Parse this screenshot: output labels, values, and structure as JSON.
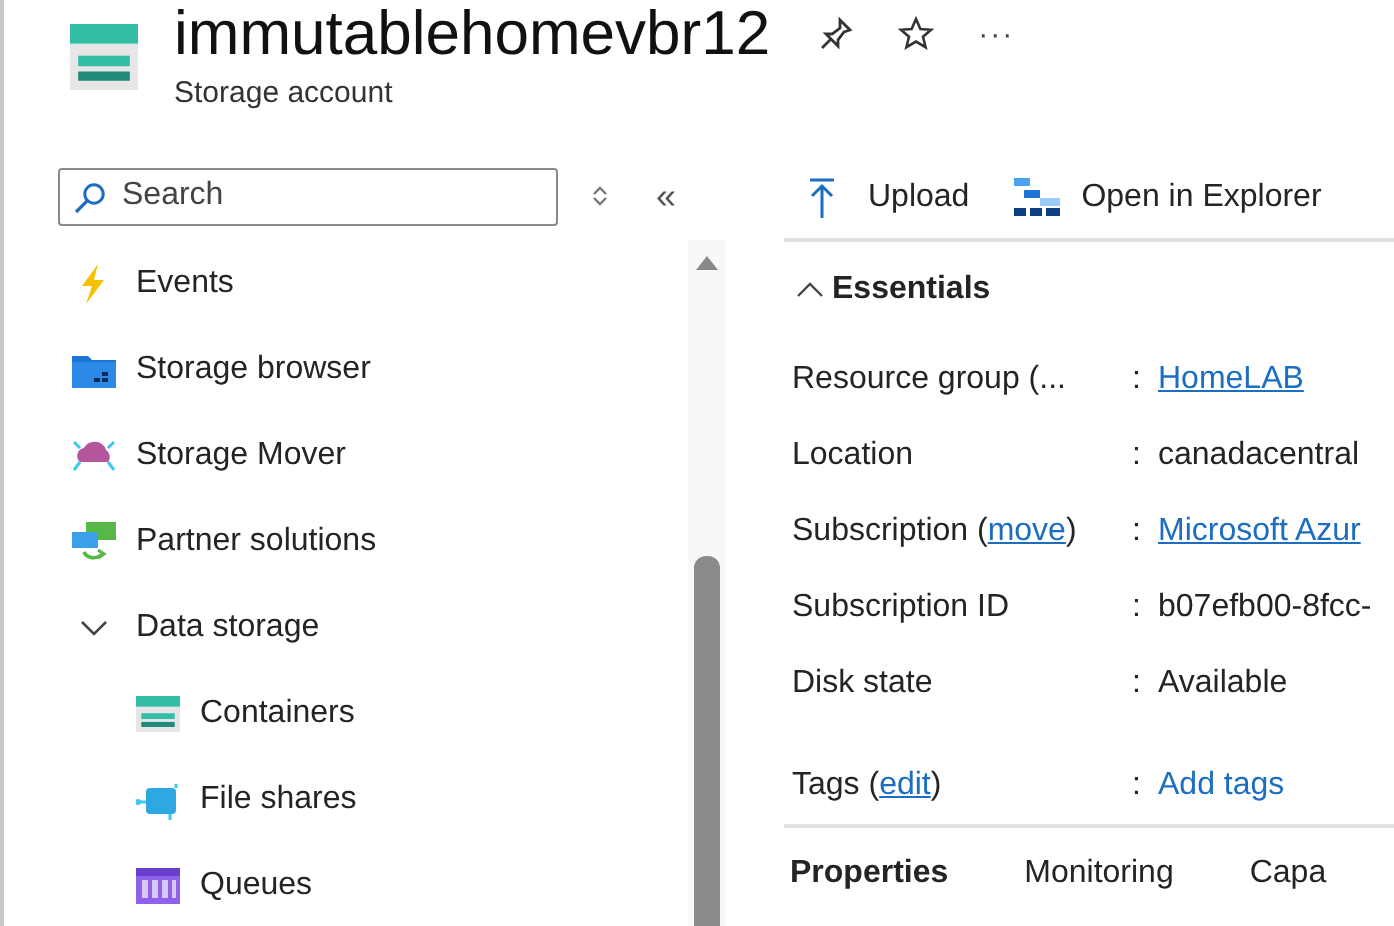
{
  "header": {
    "title": "immutablehomevbr12",
    "subtitle": "Storage account",
    "more": "···"
  },
  "sidebar": {
    "search": {
      "placeholder": "Search"
    },
    "collapse": "«",
    "items": [
      {
        "kind": "item",
        "label": "Events"
      },
      {
        "kind": "item",
        "label": "Storage browser"
      },
      {
        "kind": "item",
        "label": "Storage Mover"
      },
      {
        "kind": "item",
        "label": "Partner solutions"
      },
      {
        "kind": "group",
        "label": "Data storage",
        "expanded": true,
        "children": [
          {
            "kind": "item",
            "label": "Containers"
          },
          {
            "kind": "item",
            "label": "File shares"
          },
          {
            "kind": "item",
            "label": "Queues"
          }
        ]
      }
    ]
  },
  "toolbar": [
    {
      "label": "Upload"
    },
    {
      "label": "Open in Explorer"
    }
  ],
  "essentials": {
    "title": "Essentials",
    "expanded": true,
    "rows": [
      {
        "label": "Resource group (...",
        "separator": ":",
        "value": "HomeLAB",
        "kind": "link"
      },
      {
        "label": "Location",
        "separator": ":",
        "value": "canadacentral",
        "kind": "text"
      },
      {
        "label": "Subscription (",
        "label_link": "move",
        "label_end": ")",
        "separator": ":",
        "value": "Microsoft Azur",
        "kind": "link"
      },
      {
        "label": "Subscription ID",
        "separator": ":",
        "value": "b07efb00-8fcc-",
        "kind": "text"
      },
      {
        "label": "Disk state",
        "separator": ":",
        "value": "Available",
        "kind": "text"
      },
      {
        "label": "Tags (",
        "label_link": "edit",
        "label_end": ")",
        "separator": ":",
        "value": "Add tags",
        "kind": "action"
      }
    ]
  },
  "tabs": [
    {
      "label": "Properties",
      "selected": true
    },
    {
      "label": "Monitoring",
      "selected": false
    },
    {
      "label": "Capa",
      "selected": false
    }
  ]
}
